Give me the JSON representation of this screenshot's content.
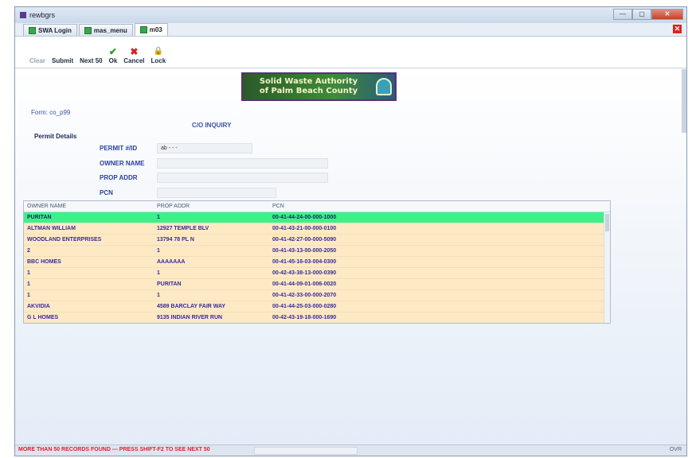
{
  "window": {
    "title": "rewbgrs",
    "controls": [
      "—",
      "▢",
      "✕"
    ]
  },
  "tabs": [
    {
      "label": "SWA Login"
    },
    {
      "label": "mas_menu"
    },
    {
      "label": "m03"
    }
  ],
  "tab_close": "✕",
  "toolbar": {
    "buttons": [
      {
        "label": "Clear",
        "glyph": ""
      },
      {
        "label": "Submit",
        "glyph": ""
      },
      {
        "label": "Next 50",
        "glyph": ""
      },
      {
        "label": "Ok",
        "glyph": "✔"
      },
      {
        "label": "Cancel",
        "glyph": "✖"
      },
      {
        "label": "Lock",
        "glyph": "🔒"
      }
    ]
  },
  "banner": {
    "line1": "Solid Waste Authority",
    "line2": "of Palm Beach County"
  },
  "form": {
    "form_id": "Form: co_p99",
    "inquiry_title": "C/O INQUIRY",
    "section_title": "Permit Details",
    "fields": [
      {
        "label": "PERMIT #/ID",
        "value": "ab  -  -  -"
      },
      {
        "label": "OWNER NAME",
        "value": ""
      },
      {
        "label": "PROP ADDR",
        "value": ""
      },
      {
        "label": "PCN",
        "value": ""
      }
    ]
  },
  "grid": {
    "columns": [
      "OWNER NAME",
      "PROP ADDR",
      "PCN"
    ],
    "rows": [
      {
        "owner": "PURITAN",
        "addr": "1",
        "pcn": "00-41-44-24-00-000-1000"
      },
      {
        "owner": "ALTMAN WILLIAM",
        "addr": "12927 TEMPLE BLV",
        "pcn": "00-41-43-21-00-000-0100"
      },
      {
        "owner": "WOODLAND ENTERPRISES",
        "addr": "13794 78 PL N",
        "pcn": "00-41-42-27-00-000-5090"
      },
      {
        "owner": "2",
        "addr": "1",
        "pcn": "00-41-43-13-00-000-2050"
      },
      {
        "owner": "BBC HOMES",
        "addr": "AAAAAAA",
        "pcn": "00-41-45-16-03-004-0300"
      },
      {
        "owner": "1",
        "addr": "1",
        "pcn": "00-42-43-38-13-000-0390"
      },
      {
        "owner": "1",
        "addr": "PURITAN",
        "pcn": "00-41-44-09-01-006-0020"
      },
      {
        "owner": "1",
        "addr": "1",
        "pcn": "00-41-42-33-00-000-2070"
      },
      {
        "owner": "AKVIDIA",
        "addr": "4589 BARCLAY FAIR WAY",
        "pcn": "00-41-44-25-03-000-0280"
      },
      {
        "owner": "G L HOMES",
        "addr": "9135 INDIAN RIVER RUN",
        "pcn": "00-42-43-19-18-000-1690"
      }
    ]
  },
  "status": {
    "message": "MORE THAN 50 RECORDS FOUND --- PRESS SHIFT-F2 TO SEE NEXT 50",
    "right_text": "OVR"
  },
  "colors": {
    "selected_row": "#3ff08a",
    "row_bg": "#fde9c4",
    "error_text": "#e0202a",
    "label_blue": "#2a3fa0"
  }
}
